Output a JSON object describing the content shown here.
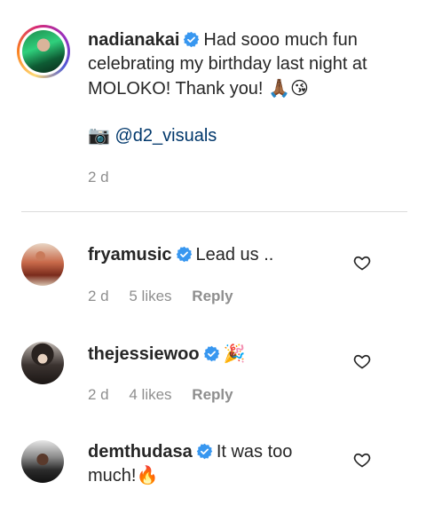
{
  "caption": {
    "username": "nadianakai",
    "text": "Had sooo much fun celebrating my birthday last night at MOLOKO! Thank you!",
    "emojis": "🙏🏾😘",
    "camera_emoji": "📷",
    "credit_handle": "@d2_visuals",
    "time": "2 d"
  },
  "comments": [
    {
      "username": "fryamusic",
      "text": "Lead us ..",
      "time": "2 d",
      "likes": "5 likes",
      "reply": "Reply"
    },
    {
      "username": "thejessiewoo",
      "text": "🎉",
      "time": "2 d",
      "likes": "4 likes",
      "reply": "Reply"
    },
    {
      "username": "demthudasa",
      "text": "It was too much!🔥"
    }
  ],
  "colors": {
    "verified": "#3897f0",
    "muted": "#8e8e8e",
    "link": "#00376b"
  },
  "icons": {
    "verified": "verified-badge-icon",
    "like": "heart-icon"
  }
}
